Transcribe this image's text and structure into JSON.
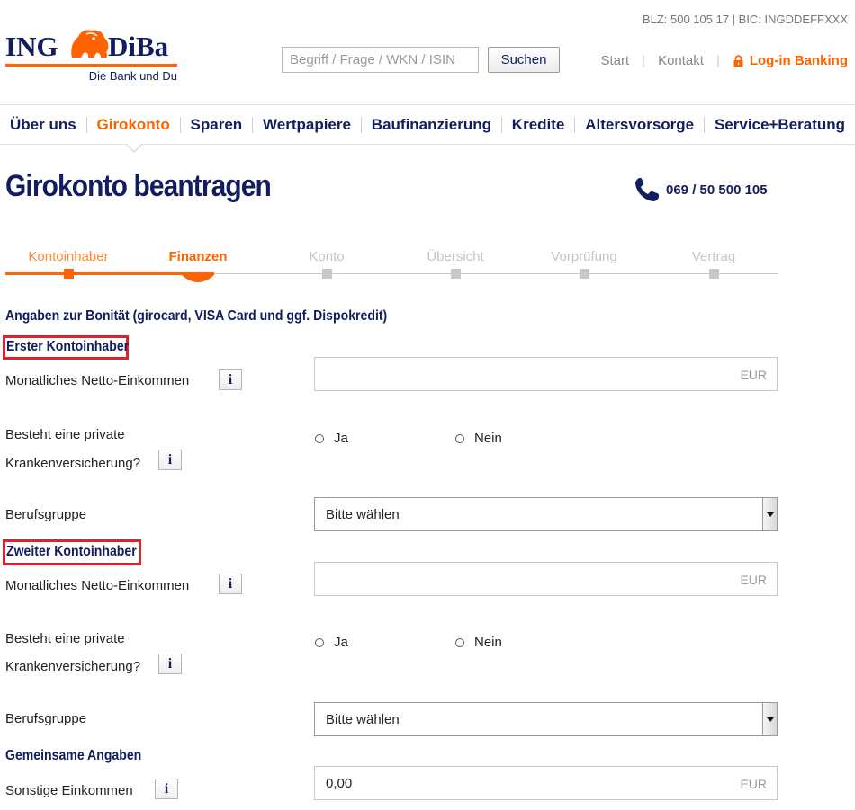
{
  "header": {
    "bank_codes": "BLZ: 500 105 17 | BIC: INGDDEFFXXX",
    "logo": {
      "left": "ING",
      "right": "DiBa",
      "slogan": "Die Bank und Du",
      "icon": "lion-icon"
    },
    "search": {
      "placeholder": "Begriff / Frage / WKN / ISIN",
      "button": "Suchen"
    },
    "links": {
      "start": "Start",
      "contact": "Kontakt",
      "login": "Log-in Banking"
    },
    "colors": {
      "brand_blue": "#111d5e",
      "brand_orange": "#ff6200",
      "highlight_red": "#e0202a"
    }
  },
  "nav": {
    "items": [
      "Über uns",
      "Girokonto",
      "Sparen",
      "Wertpapiere",
      "Baufinanzierung",
      "Kredite",
      "Altersvorsorge",
      "Service+Beratung"
    ],
    "active": "Girokonto"
  },
  "page": {
    "title": "Girokonto beantragen",
    "phone": "069 / 50 500 105"
  },
  "stepper": {
    "steps": [
      "Kontoinhaber",
      "Finanzen",
      "Konto",
      "Übersicht",
      "Vorprüfung",
      "Vertrag"
    ],
    "current_step": "Finanzen"
  },
  "form": {
    "intro": "Angaben zur Bonität (girocard, VISA Card und ggf. Dispokredit)",
    "first_holder": {
      "heading": "Erster Kontoinhaber",
      "income_label": "Monatliches Netto-Einkommen",
      "income_value": "",
      "insurance_label_line1": "Besteht eine private",
      "insurance_label_line2": "Krankenversicherung?",
      "yes": "Ja",
      "no": "Nein",
      "job_label": "Berufsgruppe",
      "job_value": "Bitte wählen"
    },
    "second_holder": {
      "heading": "Zweiter Kontoinhaber",
      "income_label": "Monatliches Netto-Einkommen",
      "income_value": "",
      "insurance_label_line1": "Besteht eine private",
      "insurance_label_line2": "Krankenversicherung?",
      "yes": "Ja",
      "no": "Nein",
      "job_label": "Berufsgruppe",
      "job_value": "Bitte wählen"
    },
    "shared": {
      "heading": "Gemeinsame Angaben",
      "other_income_label": "Sonstige Einkommen",
      "other_income_value": "0,00"
    },
    "currency": "EUR",
    "info_glyph": "i"
  }
}
